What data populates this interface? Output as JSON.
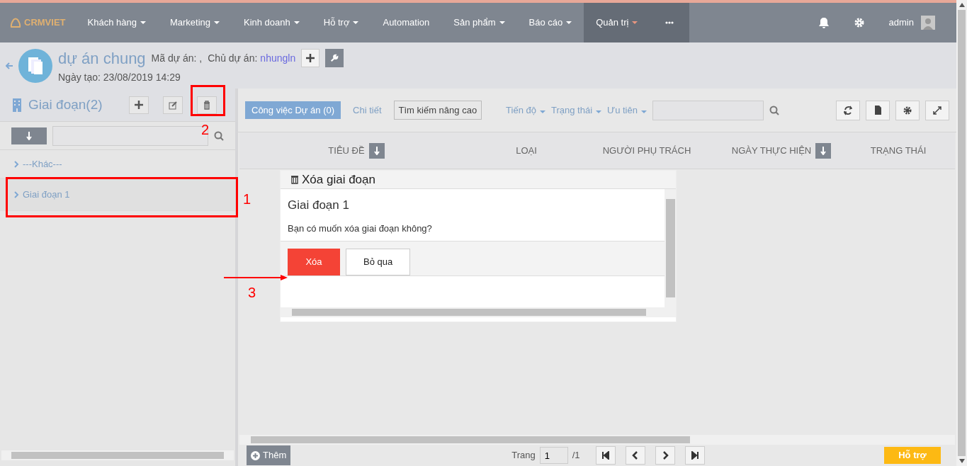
{
  "navbar": {
    "logo": "CRMVIET",
    "menu": [
      {
        "label": "Khách hàng",
        "kind": "dropdown",
        "selected": false
      },
      {
        "label": "Marketing",
        "kind": "dropdown",
        "selected": false
      },
      {
        "label": "Kinh doanh",
        "kind": "dropdown",
        "selected": false
      },
      {
        "label": "Hỗ trợ",
        "kind": "dropdown",
        "selected": false
      },
      {
        "label": "Automation",
        "kind": "link",
        "selected": false
      },
      {
        "label": "Sản phẩm",
        "kind": "dropdown",
        "selected": false
      },
      {
        "label": "Báo cáo",
        "kind": "dropdown",
        "selected": false
      },
      {
        "label": "Quản trị",
        "kind": "dropdown",
        "selected": true
      },
      {
        "kind": "more",
        "selected": true
      }
    ],
    "user": "admin"
  },
  "header": {
    "title": "dự án chung",
    "code_label": "Mã dự án: ,",
    "owner_label": "Chủ dự án:",
    "owner": "nhungln",
    "created": "Ngày tạo: 23/08/2019 14:29"
  },
  "stages": {
    "title": "Giai đoạn(2)",
    "items": [
      {
        "label": "---Khác---",
        "selected": false
      },
      {
        "label": "Giai đoạn 1",
        "selected": true
      }
    ]
  },
  "tasks": {
    "tabs": [
      {
        "label": "Công việc Dự án (0)",
        "selected": true
      },
      {
        "label": "Chi tiết",
        "selected": false
      }
    ],
    "advanced_search": "Tìm kiếm nâng cao",
    "filters": [
      "Tiến độ",
      "Trạng thái",
      "Ưu tiên"
    ],
    "columns": [
      {
        "label": "TIÊU ĐỀ",
        "sort": true
      },
      {
        "label": "LOẠI",
        "sort": false
      },
      {
        "label": "NGƯỜI PHỤ TRÁCH",
        "sort": false
      },
      {
        "label": "NGÀY THỰC HIỆN",
        "sort": true
      },
      {
        "label": "TRẠNG THÁI",
        "sort": false
      }
    ]
  },
  "dialog": {
    "title": "Xóa giai đoạn",
    "heading": "Giai đoạn 1",
    "message": "Bạn có muốn xóa giai đoạn không?",
    "buttons": [
      {
        "label": "Xóa",
        "kind": "danger"
      },
      {
        "label": "Bỏ qua",
        "kind": "default"
      }
    ]
  },
  "footer": {
    "add": "Thêm",
    "page_label": "Trang",
    "page": "1",
    "total": "/1",
    "help": "Hỗ trợ"
  },
  "annotations": [
    {
      "label": "1"
    },
    {
      "label": "2"
    },
    {
      "label": "3"
    }
  ]
}
